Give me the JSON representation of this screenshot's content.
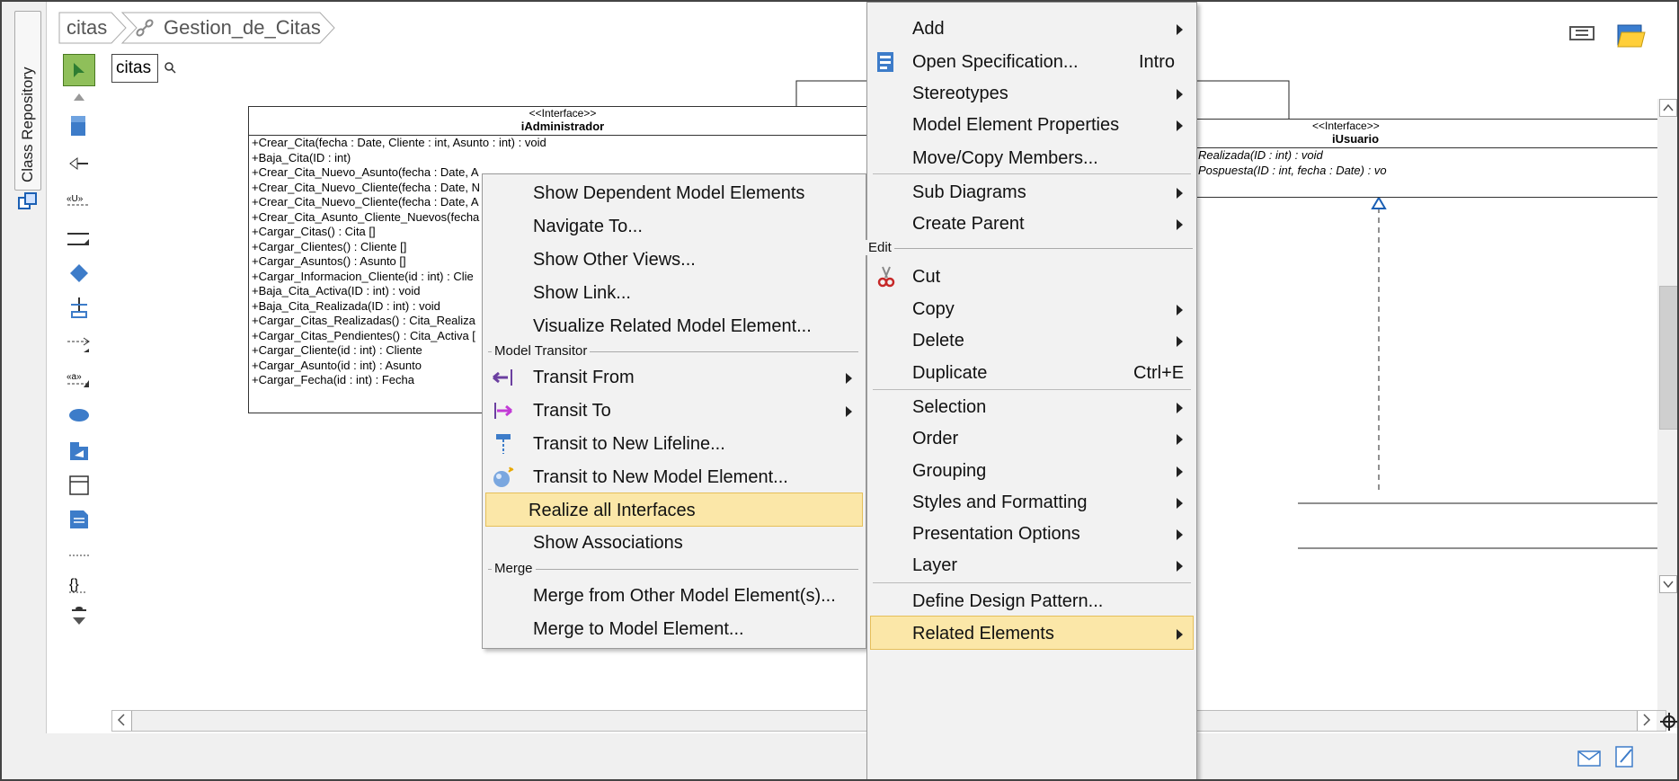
{
  "repo_tab": {
    "label": "Class Repository",
    "icon": "class-repository-icon"
  },
  "breadcrumb": {
    "items": [
      "citas",
      "Gestion_de_Citas"
    ],
    "link_icon": "link-icon"
  },
  "diagram": {
    "tab_label": "citas",
    "zoom_icon": "magnifier-icon",
    "admin_class": {
      "stereotype": "<<Interface>>",
      "name": "iAdministrador",
      "operations": [
        "+Crear_Cita(fecha : Date, Cliente : int, Asunto : int) : void",
        "+Baja_Cita(ID : int)",
        "+Crear_Cita_Nuevo_Asunto(fecha : Date, A",
        "+Crear_Cita_Nuevo_Cliente(fecha : Date, N",
        "+Crear_Cita_Nuevo_Cliente(fecha : Date, A",
        "+Crear_Cita_Asunto_Cliente_Nuevos(fecha",
        "+Cargar_Citas() : Cita []",
        "+Cargar_Clientes() : Cliente []",
        "+Cargar_Asuntos() : Asunto []",
        "+Cargar_Informacion_Cliente(id : int) : Clie",
        "+Baja_Cita_Activa(ID : int) : void",
        "+Baja_Cita_Realizada(ID : int) : void",
        "+Cargar_Citas_Realizadas() : Cita_Realiza",
        "+Cargar_Citas_Pendientes() : Cita_Activa [",
        "+Cargar_Cliente(id : int) : Cliente",
        "+Cargar_Asunto(id : int) : Asunto",
        "+Cargar_Fecha(id : int) : Fecha"
      ]
    },
    "user_class": {
      "stereotype": "<<Interface>>",
      "name": "iUsuario",
      "operations": [
        "Realizada(ID : int) : void",
        "Pospuesta(ID : int, fecha : Date) : vo"
      ]
    }
  },
  "context_menu": {
    "items": [
      {
        "label": "Show Dependent Model Elements"
      },
      {
        "label": "Navigate To..."
      },
      {
        "label": "Show Other Views..."
      },
      {
        "label": "Show Link..."
      },
      {
        "label": "Visualize Related Model Element..."
      }
    ],
    "section_transitor": "Model Transitor",
    "transit_items": [
      {
        "label": "Transit From",
        "icon": "transit-from-icon",
        "submenu": true
      },
      {
        "label": "Transit To",
        "icon": "transit-to-icon",
        "submenu": true
      },
      {
        "label": "Transit to New Lifeline...",
        "icon": "lifeline-icon"
      },
      {
        "label": "Transit to New Model Element...",
        "icon": "new-model-element-icon"
      }
    ],
    "realize": "Realize all Interfaces",
    "associations": "Show Associations",
    "section_merge": "Merge",
    "merge_items": [
      {
        "label": "Merge from Other Model Element(s)..."
      },
      {
        "label": "Merge to Model Element..."
      }
    ]
  },
  "main_menu": {
    "top_items": [
      {
        "label": "Add",
        "submenu": true
      },
      {
        "label": "Open Specification...",
        "shortcut": "Intro",
        "icon": "specification-icon"
      },
      {
        "label": "Stereotypes",
        "submenu": true
      },
      {
        "label": "Model Element Properties",
        "submenu": true
      },
      {
        "label": "Move/Copy Members..."
      }
    ],
    "mid_items": [
      {
        "label": "Sub Diagrams",
        "submenu": true
      },
      {
        "label": "Create Parent",
        "submenu": true
      }
    ],
    "section_edit": "Edit",
    "edit_items": [
      {
        "label": "Cut",
        "icon": "scissors-icon"
      },
      {
        "label": "Copy",
        "submenu": true
      },
      {
        "label": "Delete",
        "submenu": true
      },
      {
        "label": "Duplicate",
        "shortcut": "Ctrl+E"
      }
    ],
    "lower_items": [
      {
        "label": "Selection",
        "submenu": true
      },
      {
        "label": "Order",
        "submenu": true
      },
      {
        "label": "Grouping",
        "submenu": true
      },
      {
        "label": "Styles and Formatting",
        "submenu": true
      },
      {
        "label": "Presentation Options",
        "submenu": true
      },
      {
        "label": "Layer",
        "submenu": true
      }
    ],
    "pattern": "Define Design Pattern...",
    "related": "Related Elements"
  },
  "colors": {
    "highlight": "#fbe7a8",
    "menu_bg": "#f2f2f2"
  }
}
